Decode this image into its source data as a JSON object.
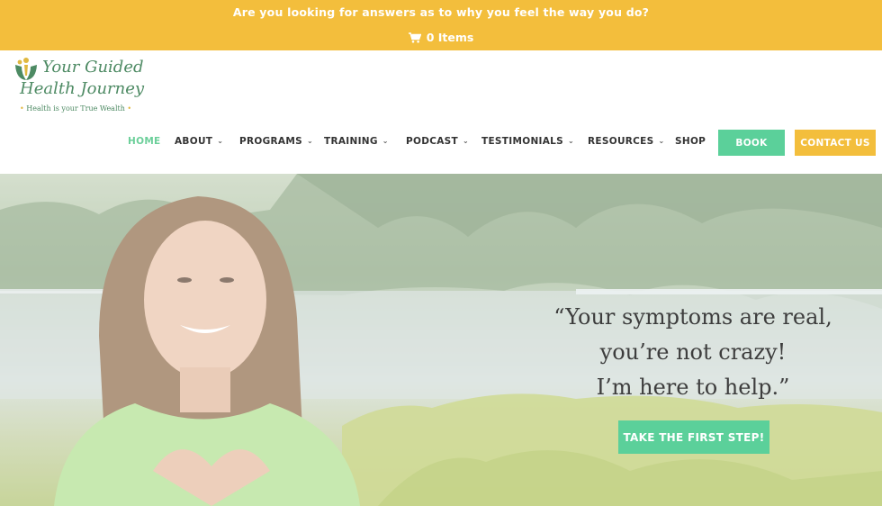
{
  "topbar": {
    "message": "Are you looking for answers as to why you feel the way you do?",
    "cart_label": "0 Items",
    "cart_icon": "shopping-cart-icon",
    "background_color": "#f3be3c"
  },
  "logo": {
    "line1": "Your Guided",
    "line2": "Health Journey",
    "tagline": "Health is your True Wealth",
    "tag_bullet": "•"
  },
  "nav": {
    "items": [
      {
        "label": "HOME",
        "active": true,
        "has_dropdown": false
      },
      {
        "label": "ABOUT",
        "active": false,
        "has_dropdown": true
      },
      {
        "label": "PROGRAMS",
        "active": false,
        "has_dropdown": true
      },
      {
        "label": "TRAINING",
        "active": false,
        "has_dropdown": true
      },
      {
        "label": "PODCAST",
        "active": false,
        "has_dropdown": true
      },
      {
        "label": "TESTIMONIALS",
        "active": false,
        "has_dropdown": true
      },
      {
        "label": "RESOURCES",
        "active": false,
        "has_dropdown": true
      },
      {
        "label": "SHOP",
        "active": false,
        "has_dropdown": false
      }
    ],
    "chevron": "⌄",
    "book_label": "BOOK",
    "contact_label": "CONTACT US",
    "accent_green": "#5bd09a",
    "accent_yellow": "#f3be3c"
  },
  "hero": {
    "quote_lines": [
      "“Your symptoms are real,",
      "you’re not crazy!",
      "I’m here to help.”"
    ],
    "cta_label": "TAKE THE FIRST STEP!"
  }
}
